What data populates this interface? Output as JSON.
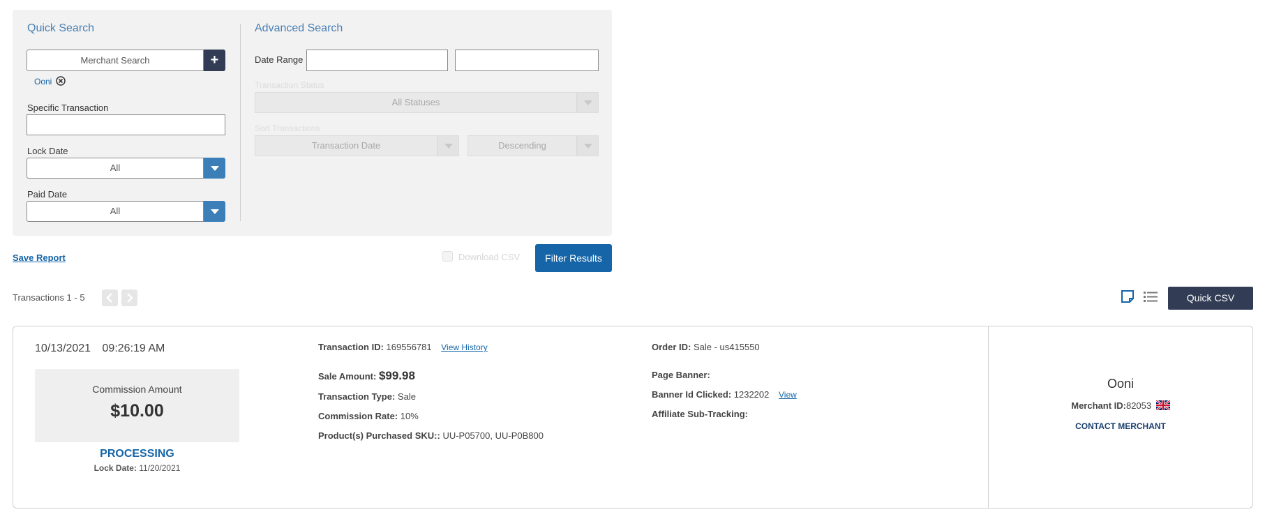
{
  "quick_search": {
    "title": "Quick Search",
    "merchant_search_placeholder": "Merchant Search",
    "add_icon_glyph": "+",
    "selected_merchant": "Ooni",
    "specific_transaction_label": "Specific Transaction",
    "specific_transaction_value": "",
    "lock_date_label": "Lock Date",
    "lock_date_value": "All",
    "paid_date_label": "Paid Date",
    "paid_date_value": "All"
  },
  "advanced_search": {
    "title": "Advanced Search",
    "date_range_label": "Date Range",
    "date_from": "",
    "date_to": "",
    "transaction_status_label": "Transaction Status",
    "transaction_status_value": "All Statuses",
    "sort_label": "Sort Transactions",
    "sort_field_value": "Transaction Date",
    "sort_order_value": "Descending"
  },
  "actions": {
    "save_report": "Save Report",
    "download_csv": "Download CSV",
    "filter_results": "Filter Results"
  },
  "results": {
    "range_text": "Transactions 1 - 5",
    "quick_csv": "Quick CSV"
  },
  "transaction": {
    "date": "10/13/2021",
    "time": "09:26:19 AM",
    "commission_label": "Commission Amount",
    "commission_amount": "$10.00",
    "status": "PROCESSING",
    "lock_date_label": "Lock Date:",
    "lock_date_value": "11/20/2021",
    "transaction_id_label": "Transaction ID:",
    "transaction_id_value": "169556781",
    "view_history": "View History",
    "sale_amount_label": "Sale Amount:",
    "sale_amount_value": "$99.98",
    "transaction_type_label": "Transaction Type:",
    "transaction_type_value": "Sale",
    "commission_rate_label": "Commission Rate:",
    "commission_rate_value": "10%",
    "skus_label": "Product(s) Purchased SKU::",
    "skus_value": "UU-P05700, UU-P0B800",
    "order_id_label": "Order ID:",
    "order_id_value": "Sale - us415550",
    "page_banner_label": "Page Banner:",
    "banner_id_label": "Banner Id Clicked:",
    "banner_id_value": "1232202",
    "banner_view": "View",
    "sub_tracking_label": "Affiliate Sub-Tracking:",
    "merchant_name": "Ooni",
    "merchant_id_label": "Merchant ID:",
    "merchant_id_value": "82053",
    "merchant_flag": "uk-flag-icon",
    "contact_merchant": "CONTACT MERCHANT"
  },
  "colors": {
    "accent": "#1565a8",
    "dark_button": "#323d55",
    "dropdown_button": "#3c7fb8",
    "section_title": "#4a7fb3",
    "status_processing": "#1565a8"
  }
}
